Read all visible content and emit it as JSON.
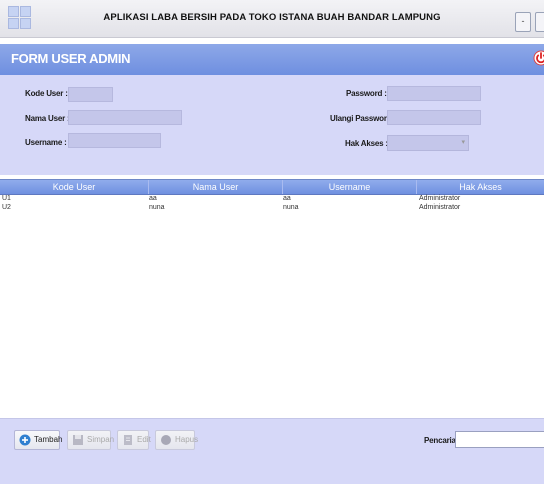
{
  "window": {
    "title": "APLIKASI LABA BERSIH PADA TOKO ISTANA BUAH BANDAR LAMPUNG",
    "min_label": "-"
  },
  "header": {
    "title": "FORM USER ADMIN",
    "power_icon": "power-icon",
    "accent_color": "#7b97e4"
  },
  "form": {
    "kode_user_label": "Kode User :",
    "kode_user_value": "",
    "nama_user_label": "Nama User :",
    "nama_user_value": "",
    "username_label": "Username :",
    "username_value": "",
    "password_label": "Password :",
    "password_value": "",
    "ulangi_password_label": "Ulangi Password :",
    "ulangi_password_value": "",
    "hak_akses_label": "Hak Akses :",
    "hak_akses_value": ""
  },
  "table": {
    "columns": [
      "Kode User",
      "Nama User",
      "Username",
      "Hak Akses"
    ],
    "rows": [
      [
        "U1",
        "aa",
        "aa",
        "Administrator"
      ],
      [
        "U2",
        "nuna",
        "nuna",
        "Administrator"
      ]
    ]
  },
  "buttons": {
    "tambah": "Tambah",
    "simpan": "Simpan",
    "edit": "Edit",
    "hapus": "Hapus"
  },
  "search": {
    "label": "Pencarian :",
    "value": ""
  }
}
